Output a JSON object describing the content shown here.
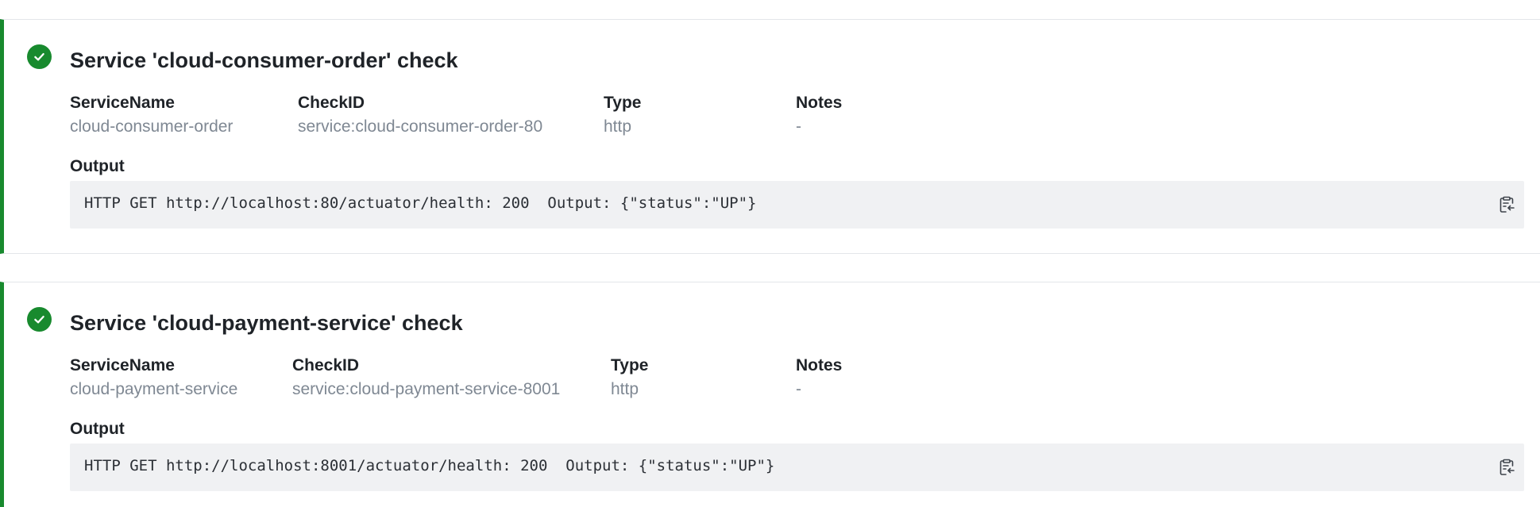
{
  "checks": [
    {
      "title": "Service 'cloud-consumer-order' check",
      "status": "passing",
      "status_icon": "check-circle-icon",
      "fields": {
        "service_name": {
          "label": "ServiceName",
          "value": "cloud-consumer-order"
        },
        "check_id": {
          "label": "CheckID",
          "value": "service:cloud-consumer-order-80"
        },
        "type": {
          "label": "Type",
          "value": "http"
        },
        "notes": {
          "label": "Notes",
          "value": "-"
        }
      },
      "output_label": "Output",
      "output": "HTTP GET http://localhost:80/actuator/health: 200  Output: {\"status\":\"UP\"}",
      "copy_icon": "clipboard-copy-icon"
    },
    {
      "title": "Service 'cloud-payment-service' check",
      "status": "passing",
      "status_icon": "check-circle-icon",
      "fields": {
        "service_name": {
          "label": "ServiceName",
          "value": "cloud-payment-service"
        },
        "check_id": {
          "label": "CheckID",
          "value": "service:cloud-payment-service-8001"
        },
        "type": {
          "label": "Type",
          "value": "http"
        },
        "notes": {
          "label": "Notes",
          "value": "-"
        }
      },
      "output_label": "Output",
      "output": "HTTP GET http://localhost:8001/actuator/health: 200  Output: {\"status\":\"UP\"}",
      "copy_icon": "clipboard-copy-icon"
    }
  ],
  "colors": {
    "passing_accent": "#188a2e",
    "label_text": "#1f2328",
    "value_text": "#7f8893",
    "output_background": "#f0f1f3",
    "divider": "#e3e6ea"
  }
}
